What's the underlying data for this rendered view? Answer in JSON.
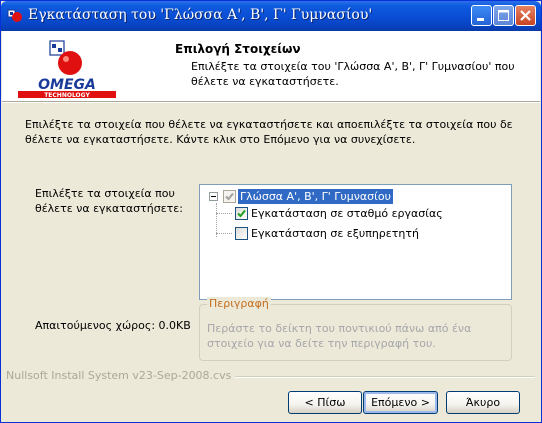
{
  "window": {
    "title": "Εγκατάσταση του 'Γλώσσα Α', Β', Γ' Γυμνασίου'",
    "controls": {
      "minimize": "minimize-icon",
      "maximize": "maximize-icon",
      "close": "close-icon"
    }
  },
  "header": {
    "title": "Επιλογή Στοιχείων",
    "subtitle": "Επιλέξτε τα στοιχεία του 'Γλώσσα Α', Β', Γ' Γυμνασίου' που θέλετε να εγκαταστήσετε.",
    "logo_text": "OMEGA",
    "logo_subtext": "TECHNOLOGY"
  },
  "intro": "Επιλέξτε τα στοιχεία που θέλετε να εγκαταστήσετε και αποεπιλέξτε τα στοιχεία που δε θέλετε να εγκαταστήσετε. Κάντε κλικ στο Επόμενο για να συνεχίσετε.",
  "components": {
    "label": "Επιλέξτε τα στοιχεία που θέλετε να εγκαταστήσετε:",
    "tree": {
      "root": {
        "label": "Γλώσσα Α', Β', Γ' Γυμνασίου",
        "state": "partial",
        "expanded": true
      },
      "children": [
        {
          "label": "Εγκατάσταση σε σταθμό εργασίας",
          "checked": true
        },
        {
          "label": "Εγκατάσταση σε εξυπηρετητή",
          "checked": false
        }
      ]
    }
  },
  "description": {
    "legend": "Περιγραφή",
    "text": "Περάστε το δείκτη του ποντικιού πάνω από ένα στοιχείο για να δείτε την περιγραφή του."
  },
  "space_required": "Απαιτούμενος χώρος: 0.0KB",
  "branding": "Nullsoft Install System v23-Sep-2008.cvs",
  "buttons": {
    "back": "< Πίσω",
    "next": "Επόμενο >",
    "cancel": "Άκυρο"
  },
  "colors": {
    "titlebar": "#0a4fd6",
    "selection": "#316ac5",
    "legend": "#c46e1e",
    "logo_red": "#e01010",
    "logo_blue": "#1a3a9a"
  }
}
